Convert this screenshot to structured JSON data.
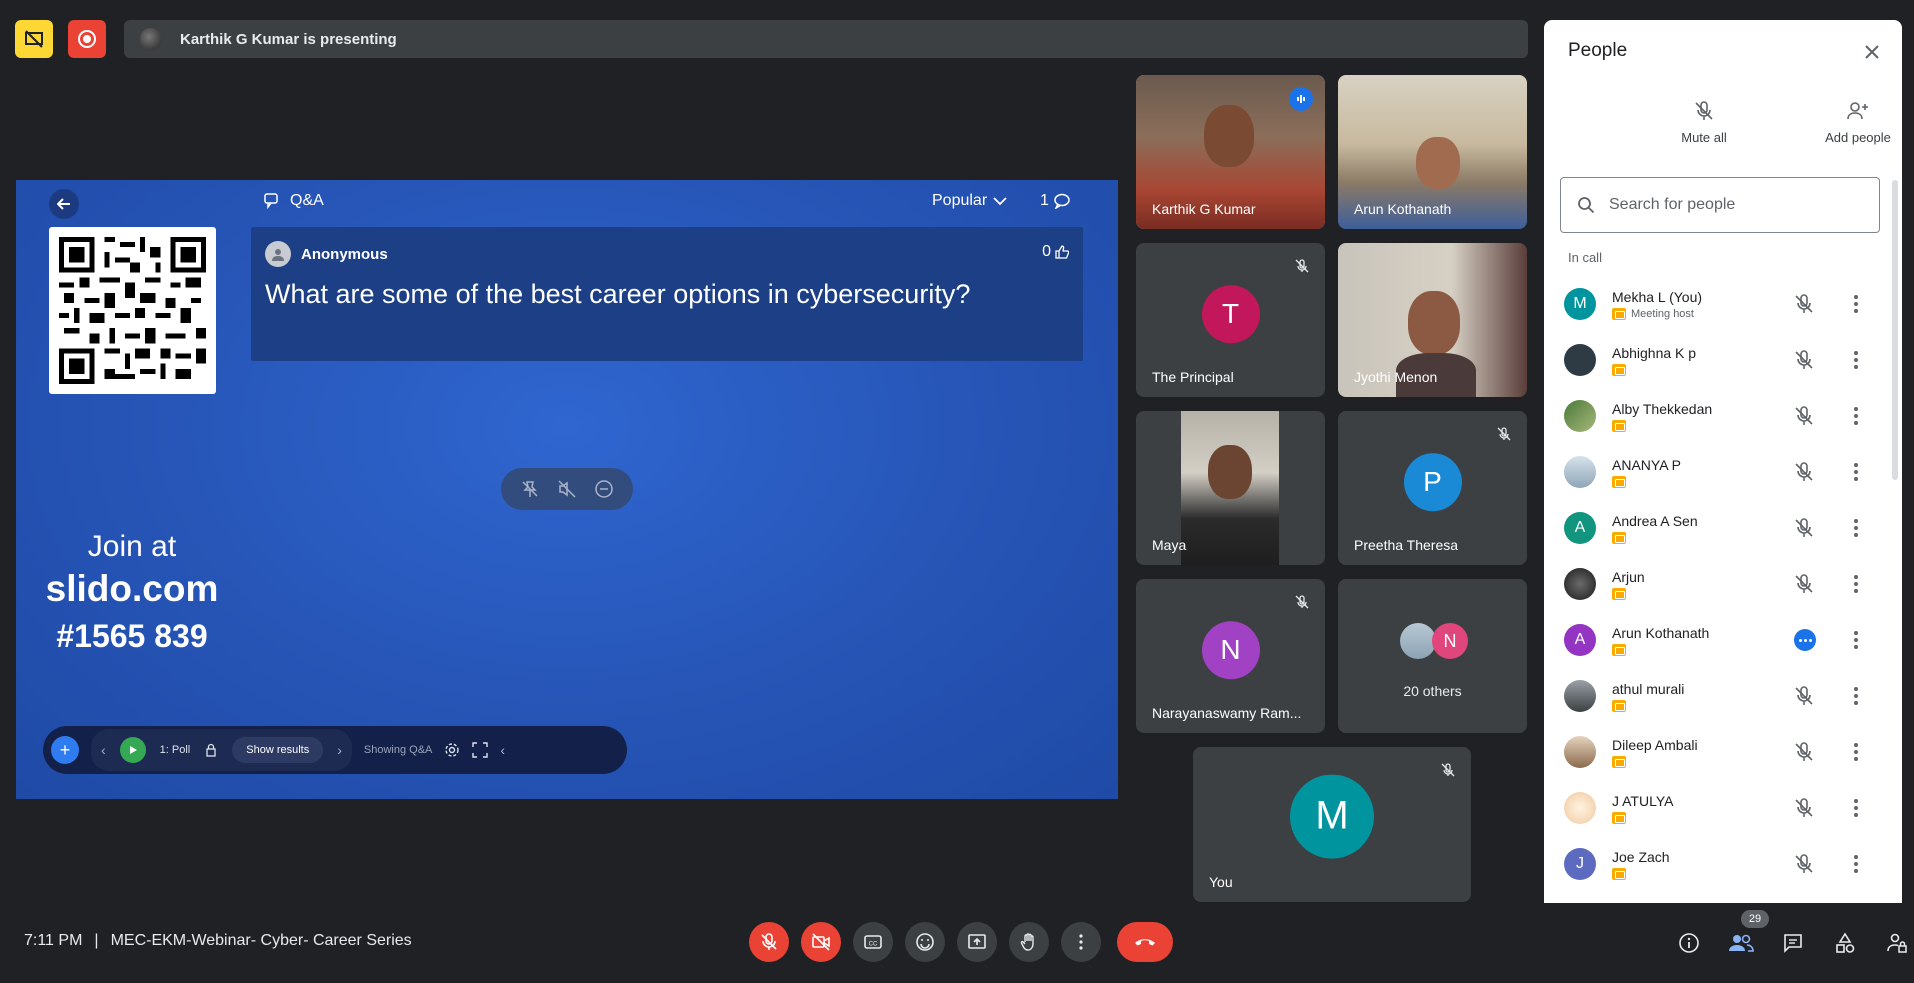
{
  "top_bar": {
    "presenting_text": "Karthik G Kumar is presenting"
  },
  "slide": {
    "qa_title": "Q&A",
    "sort_label": "Popular",
    "question_count": "1",
    "question": {
      "author": "Anonymous",
      "likes": "0",
      "text": "What are some of the best career options in cybersecurity?"
    },
    "join": {
      "join_at": "Join at",
      "domain": "slido.com",
      "code": "#1565 839"
    },
    "toolbar": {
      "poll_label": "1: Poll",
      "show_results": "Show results",
      "showing": "Showing Q&A"
    }
  },
  "tiles": [
    {
      "name": "Karthik G Kumar",
      "type": "video"
    },
    {
      "name": "Arun Kothanath",
      "type": "video"
    },
    {
      "name": "The Principal",
      "type": "avatar",
      "initial": "T",
      "color": "#c2185b"
    },
    {
      "name": "Jyothi Menon",
      "type": "video"
    },
    {
      "name": "Maya",
      "type": "video"
    },
    {
      "name": "Preetha Theresa",
      "type": "avatar",
      "initial": "P",
      "color": "#1a8ad6"
    },
    {
      "name": "Narayanaswamy Ram...",
      "type": "avatar",
      "initial": "N",
      "color": "#a142c4"
    },
    {
      "name": "20 others",
      "type": "others",
      "initial": "N",
      "color": "#e0457b"
    },
    {
      "name": "You",
      "type": "avatar",
      "initial": "M",
      "color": "#00959e"
    }
  ],
  "people_panel": {
    "title": "People",
    "mute_all": "Mute all",
    "add_people": "Add people",
    "search_placeholder": "Search for people",
    "section_label": "In call",
    "people": [
      {
        "name": "Mekha L (You)",
        "sub": "Meeting host",
        "initial": "M",
        "color": "#00959e"
      },
      {
        "name": "Abhighna K p",
        "sub": "",
        "initial": "",
        "color": "#2e3a44"
      },
      {
        "name": "Alby Thekkedan",
        "sub": "",
        "initial": "",
        "color": "#6d8c4a"
      },
      {
        "name": "ANANYA P",
        "sub": "",
        "initial": "",
        "color": "#9fb6c6"
      },
      {
        "name": "Andrea A Sen",
        "sub": "",
        "initial": "A",
        "color": "#12957f"
      },
      {
        "name": "Arjun",
        "sub": "",
        "initial": "",
        "color": "#2a2a2a"
      },
      {
        "name": "Arun Kothanath",
        "sub": "",
        "initial": "A",
        "color": "#9334c2"
      },
      {
        "name": "athul murali",
        "sub": "",
        "initial": "",
        "color": "#5d6470"
      },
      {
        "name": "Dileep Ambali",
        "sub": "",
        "initial": "",
        "color": "#b9a186"
      },
      {
        "name": "J ATULYA",
        "sub": "",
        "initial": "",
        "color": "#f0c8a0"
      },
      {
        "name": "Joe Zach",
        "sub": "",
        "initial": "J",
        "color": "#5c6bc0"
      }
    ]
  },
  "bottom": {
    "time": "7:11 PM",
    "separator": "|",
    "meeting_name": "MEC-EKM-Webinar- Cyber- Career Series",
    "participant_count": "29"
  }
}
